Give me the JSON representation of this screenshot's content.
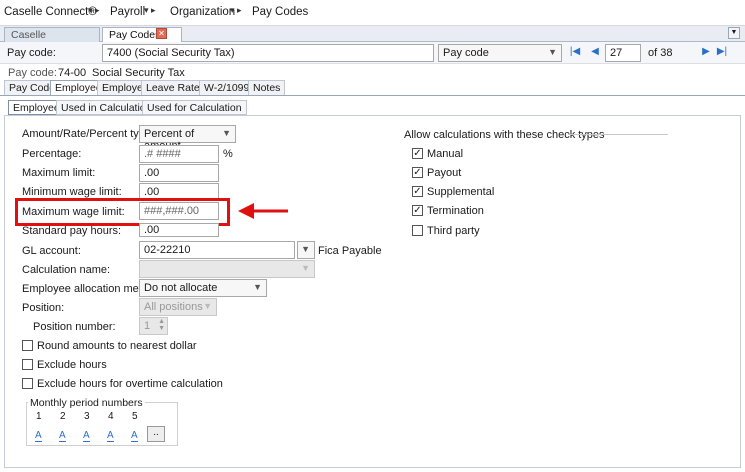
{
  "breadcrumb": {
    "items": [
      "Caselle Connect®",
      "Payroll",
      "Organization",
      "Pay Codes"
    ],
    "separator": "▸"
  },
  "doc_tabs": [
    {
      "label": "Caselle Connect®",
      "active": false
    },
    {
      "label": "Pay Codes",
      "active": true
    }
  ],
  "toolbar": {
    "pay_code_label": "Pay code:",
    "pay_code_value": "7400 (Social Security Tax)",
    "lookup_type": "Pay code",
    "record_number": "27",
    "record_total": "of 38"
  },
  "summary": {
    "label": "Pay code:",
    "code": "74-00",
    "description": "Social Security Tax"
  },
  "primary_tabs": [
    "Pay Code",
    "Employee",
    "Employer",
    "Leave Rates",
    "W-2/1099",
    "Notes"
  ],
  "secondary_tabs": [
    "Employee",
    "Used in Calculations",
    "Used for Calculation"
  ],
  "form": {
    "amount_type_label": "Amount/Rate/Percent type:",
    "amount_type_value": "Percent of amount",
    "percentage_label": "Percentage:",
    "percentage_value": ".# ####",
    "percentage_unit": "%",
    "max_limit_label": "Maximum limit:",
    "max_limit_value": ".00",
    "min_wage_label": "Minimum wage limit:",
    "min_wage_value": ".00",
    "max_wage_label": "Maximum wage limit:",
    "max_wage_value": "###,###.00",
    "std_hours_label": "Standard pay hours:",
    "std_hours_value": ".00",
    "gl_label": "GL account:",
    "gl_value": "02-22210",
    "gl_description": "Fica Payable",
    "calc_name_label": "Calculation name:",
    "alloc_label": "Employee allocation method:",
    "alloc_value": "Do not allocate",
    "position_label": "Position:",
    "position_value": "All positions",
    "position_number_label": "Position number:",
    "position_number_value": "1",
    "round_label": "Round amounts to nearest dollar",
    "exclude_hours_label": "Exclude hours",
    "exclude_ot_label": "Exclude hours for overtime calculation"
  },
  "monthly": {
    "title": "Monthly period numbers",
    "numbers": [
      "1",
      "2",
      "3",
      "4",
      "5"
    ],
    "values": [
      "A",
      "A",
      "A",
      "A",
      "A"
    ],
    "more_label": ".."
  },
  "check_types": {
    "title": "Allow calculations with these check types",
    "items": [
      {
        "label": "Manual",
        "checked": true
      },
      {
        "label": "Payout",
        "checked": true
      },
      {
        "label": "Supplemental",
        "checked": true
      },
      {
        "label": "Termination",
        "checked": true
      },
      {
        "label": "Third party",
        "checked": false
      }
    ]
  },
  "colors": {
    "highlight": "#e01010",
    "nav": "#2a6fc9"
  }
}
